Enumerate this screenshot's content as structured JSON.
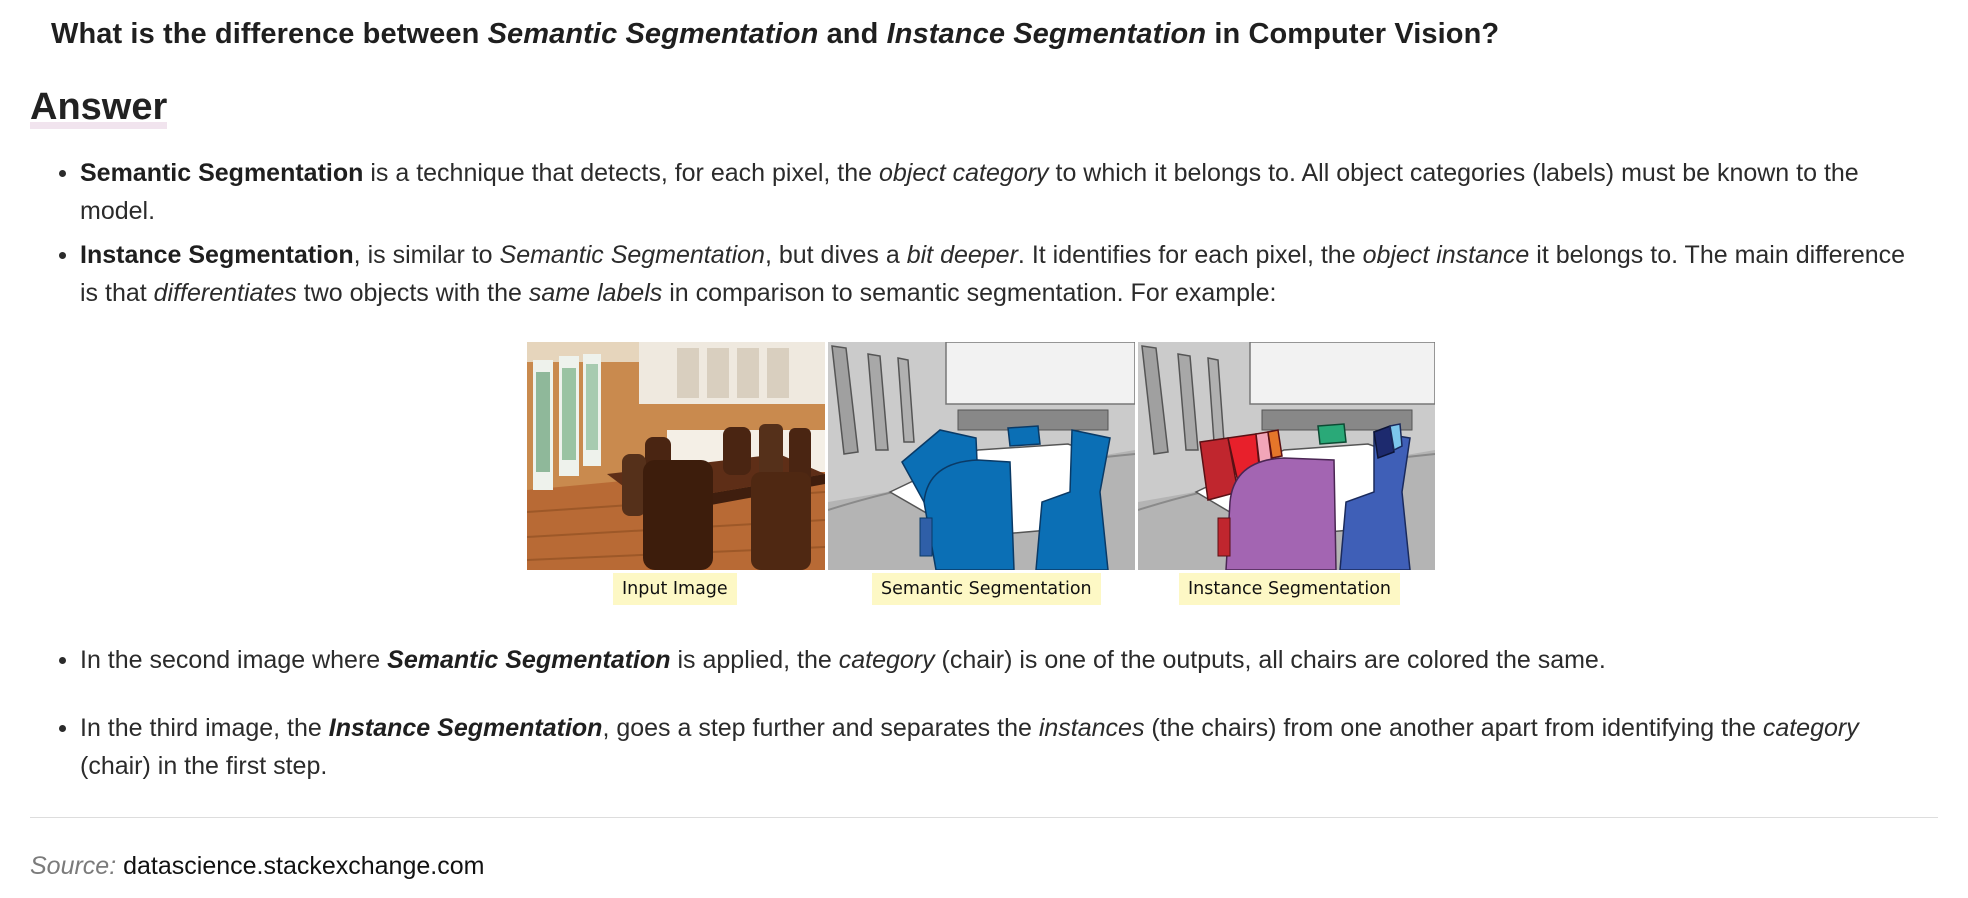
{
  "question": {
    "prefix": "What is the difference between ",
    "term1": "Semantic Segmentation",
    "middle": " and ",
    "term2": "Instance Segmentation",
    "suffix": " in Computer Vision?"
  },
  "answer_heading": "Answer",
  "bullet1": {
    "b1": "Semantic Segmentation",
    "t1": " is a technique that detects, for each pixel, the ",
    "i1": "object category",
    "t2": " to which it belongs to. All object categories (labels) must be known to the model."
  },
  "bullet2": {
    "b1": "Instance Segmentation",
    "t1": ", is similar to ",
    "i1": "Semantic Segmentation",
    "t2": ", but dives a ",
    "i2": "bit deeper",
    "t3": ". It identifies for each pixel, the ",
    "i3": "object instance",
    "t4": " it belongs to. The main difference is that ",
    "i4": "differentiates",
    "t5": " two objects with the ",
    "i5": "same labels",
    "t6": " in comparison to semantic segmentation. For example:"
  },
  "figure": {
    "captions": [
      "Input Image",
      "Semantic Segmentation",
      "Instance Segmentation"
    ],
    "colors": {
      "semantic_chair": "#0b6fb5",
      "instance_red": "#c0262e",
      "instance_pink": "#f2a5b8",
      "instance_orange": "#e5762a",
      "instance_green": "#2aa978",
      "instance_purple": "#a365b2",
      "instance_blue": "#3f5fb7",
      "instance_navy": "#1d2a6e",
      "instance_lightblue": "#7cc6ec"
    }
  },
  "bullet3": {
    "t1": "In the second image where ",
    "bi1": "Semantic Segmentation",
    "t2": " is applied, the ",
    "i1": "category",
    "t3": " (chair) is one of the outputs, all chairs are colored the same."
  },
  "bullet4": {
    "t1": "In the third image, the ",
    "bi1": "Instance Segmentation",
    "t2": ", goes a step further and separates the ",
    "i1": "instances",
    "t3": " (the chairs) from one another apart from identifying the ",
    "i2": "category",
    "t4": " (chair) in the first step."
  },
  "source": {
    "label": "Source:",
    "text": "datascience.stackexchange.com"
  }
}
